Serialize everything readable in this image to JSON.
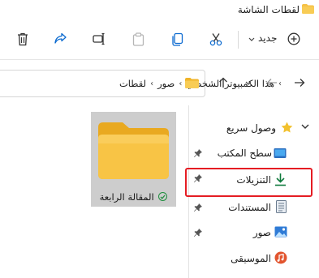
{
  "window": {
    "title": "لقطات الشاشة"
  },
  "toolbar": {
    "new_label": "جديد"
  },
  "address": {
    "crumbs": [
      "هذا الكمبيوتر الشخصي",
      "صور",
      "لقطات"
    ]
  },
  "content": {
    "folder_name": "المقالة الرابعة"
  },
  "navpane": {
    "quick_access": "وصول سريع",
    "items": [
      {
        "label": "سطح المكتب",
        "icon": "desktop-icon"
      },
      {
        "label": "التنزيلات",
        "icon": "download-icon"
      },
      {
        "label": "المستندات",
        "icon": "document-icon"
      },
      {
        "label": "صور",
        "icon": "pictures-icon"
      },
      {
        "label": "الموسيقى",
        "icon": "music-icon"
      }
    ]
  },
  "colors": {
    "folder": "#f5c146",
    "highlight": "#e51c23",
    "star": "#f2c12e",
    "accent": "#0f7a3d"
  }
}
